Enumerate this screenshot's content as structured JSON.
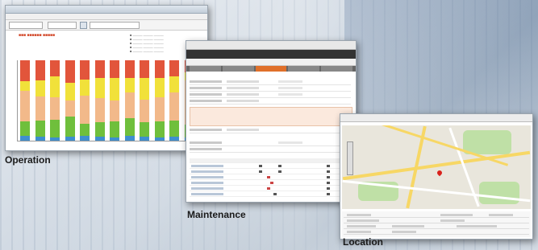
{
  "captions": {
    "operation": "Operation",
    "maintenance": "Maintenance",
    "location": "Location"
  },
  "colors": {
    "accent": "#e0702a",
    "yellow": "#f1e13a",
    "peach": "#f2b98a",
    "green": "#6fbf3c",
    "blue": "#3f8fcf",
    "red": "#e2553b",
    "map_road": "#f7d765",
    "map_park": "#bfe0a6",
    "pin": "#d9221c"
  },
  "operation_chart": {
    "bars": [
      [
        0.06,
        0.18,
        0.38,
        0.12,
        0.26
      ],
      [
        0.05,
        0.2,
        0.3,
        0.2,
        0.25
      ],
      [
        0.04,
        0.22,
        0.28,
        0.26,
        0.2
      ],
      [
        0.05,
        0.25,
        0.2,
        0.22,
        0.28
      ],
      [
        0.06,
        0.15,
        0.35,
        0.2,
        0.24
      ],
      [
        0.05,
        0.18,
        0.3,
        0.25,
        0.22
      ],
      [
        0.04,
        0.2,
        0.26,
        0.28,
        0.22
      ],
      [
        0.06,
        0.22,
        0.32,
        0.18,
        0.22
      ],
      [
        0.05,
        0.18,
        0.28,
        0.27,
        0.22
      ],
      [
        0.04,
        0.2,
        0.3,
        0.24,
        0.22
      ],
      [
        0.05,
        0.2,
        0.35,
        0.2,
        0.2
      ],
      [
        0.04,
        0.16,
        0.55,
        0.1,
        0.15
      ]
    ]
  }
}
